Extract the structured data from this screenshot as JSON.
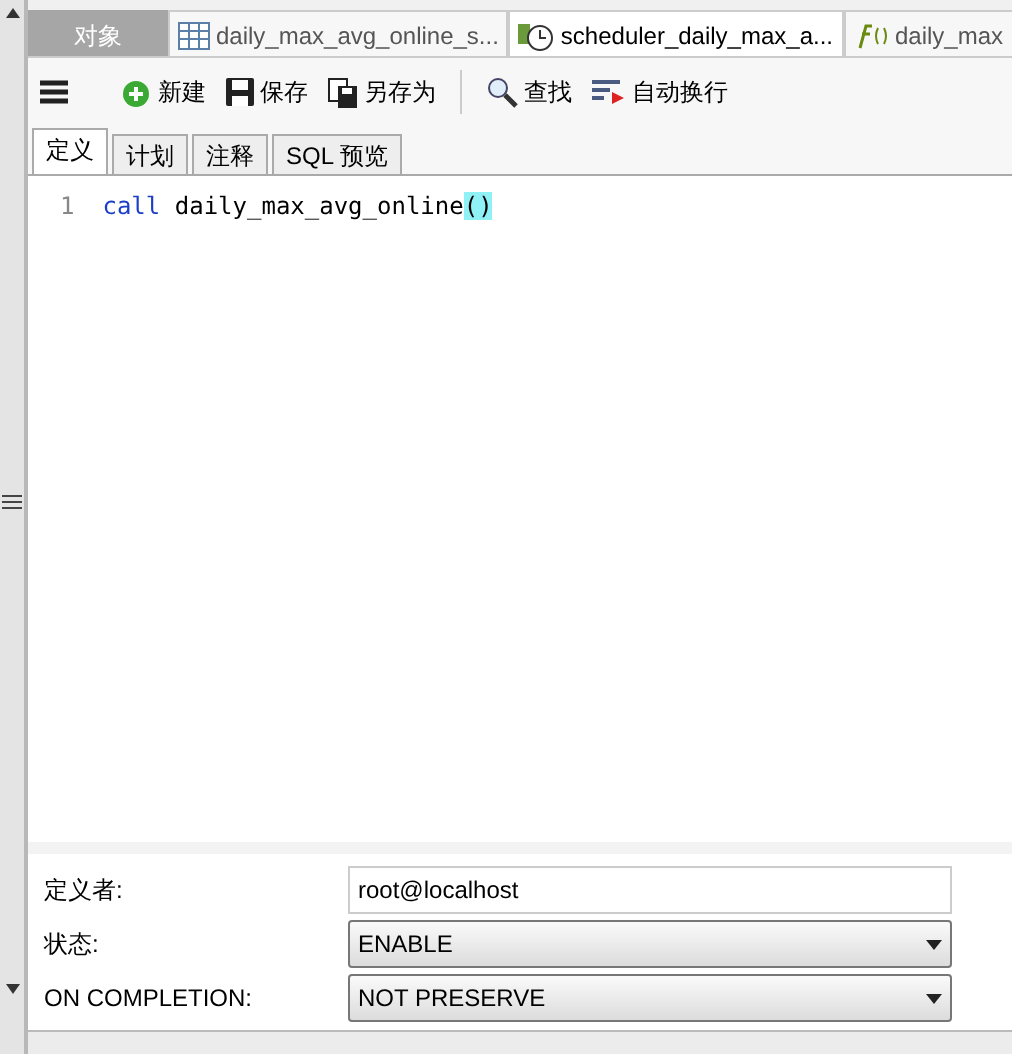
{
  "tabs": [
    {
      "label": "对象",
      "kind": "objects",
      "selected": false
    },
    {
      "label": "daily_max_avg_online_s...",
      "kind": "table",
      "selected": false
    },
    {
      "label": "scheduler_daily_max_a...",
      "kind": "event",
      "selected": true
    },
    {
      "label": "daily_max",
      "kind": "function",
      "selected": false
    }
  ],
  "toolbar": [
    {
      "label": "新建",
      "kind": "new"
    },
    {
      "label": "保存",
      "kind": "save"
    },
    {
      "label": "另存为",
      "kind": "saveas"
    },
    {
      "label": "查找",
      "kind": "find",
      "separator": true
    },
    {
      "label": "自动换行",
      "kind": "wrap"
    }
  ],
  "subtabs": [
    {
      "label": "定义",
      "selected": true
    },
    {
      "label": "计划",
      "selected": false
    },
    {
      "label": "注释",
      "selected": false
    },
    {
      "label": "SQL 预览",
      "selected": false
    }
  ],
  "editor": {
    "lines": [
      {
        "number": "1",
        "keyword": "call",
        "code": "daily_max_avg_online",
        "brackets": "()"
      }
    ]
  },
  "form": [
    {
      "label": "定义者:",
      "kind": "text",
      "value": "root@localhost"
    },
    {
      "label": "状态:",
      "kind": "select",
      "value": "ENABLE"
    },
    {
      "label": "ON COMPLETION:",
      "kind": "select",
      "value": "NOT PRESERVE"
    }
  ]
}
